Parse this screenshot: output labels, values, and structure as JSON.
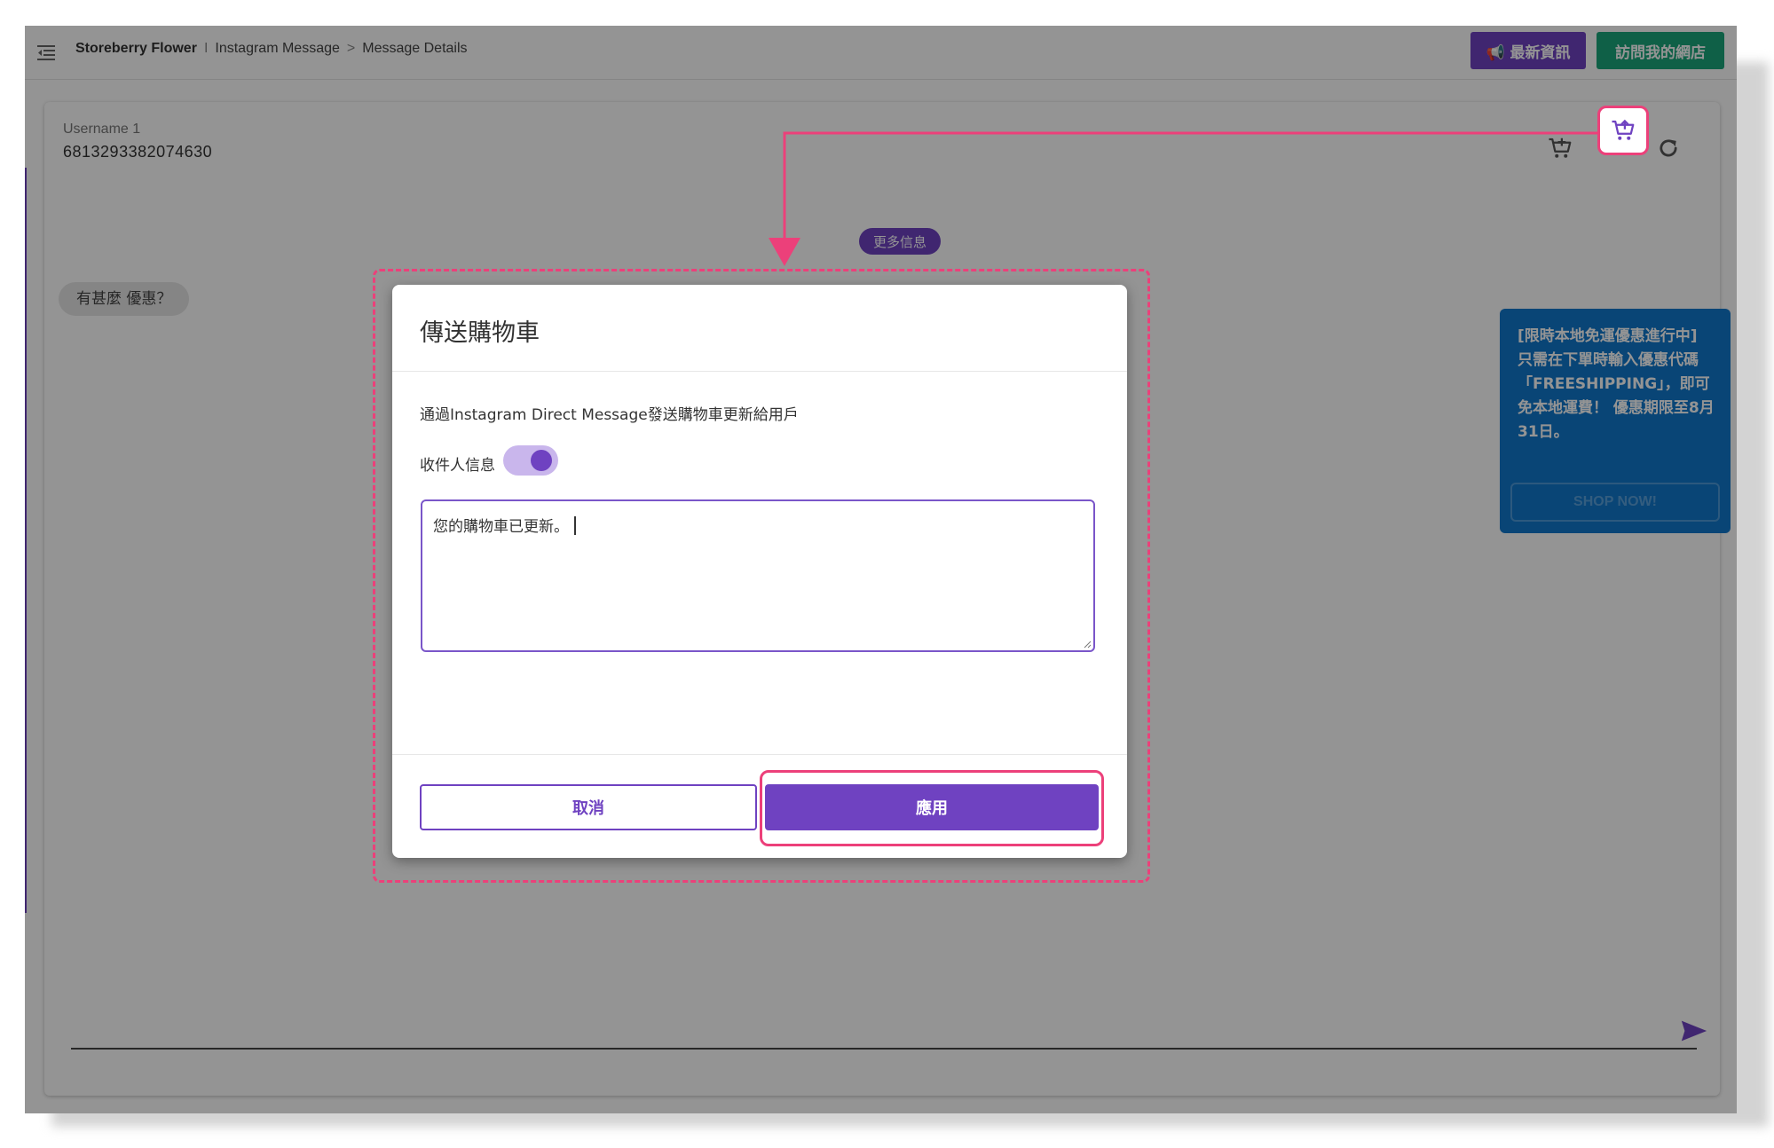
{
  "header": {
    "brand": "Storeberry Flower",
    "separator_1": "I",
    "crumb_1": "Instagram Message",
    "separator_2": ">",
    "crumb_2": "Message Details",
    "news_button": "最新資訊",
    "visit_shop_button": "訪問我的網店"
  },
  "chat": {
    "username_label": "Username 1",
    "user_id": "6813293382074630",
    "more_info_button": "更多信息",
    "customer_message": "有甚麼 優惠？"
  },
  "promo": {
    "text": "[限時本地免運優惠進行中] 只需在下單時輸入優惠代碼「FREESHIPPING」，即可免本地運費！ 優惠期限至8月31日。",
    "button": "SHOP NOW!"
  },
  "icons": {
    "menu": "menu-collapse-icon",
    "cart_add": "cart-add-icon",
    "cart_send": "cart-send-icon",
    "refresh": "refresh-icon",
    "send": "send-icon",
    "megaphone": "megaphone-icon"
  },
  "modal": {
    "title": "傳送購物車",
    "description": "通過Instagram Direct Message發送購物車更新給用戶",
    "recipient_label": "收件人信息",
    "recipient_toggle_on": true,
    "message_value": "您的購物車已更新。",
    "cancel_button": "取消",
    "apply_button": "應用"
  },
  "colors": {
    "primary": "#6f42c1",
    "success": "#1aa67a",
    "promo": "#1177cc",
    "annotation": "#ec407a"
  }
}
